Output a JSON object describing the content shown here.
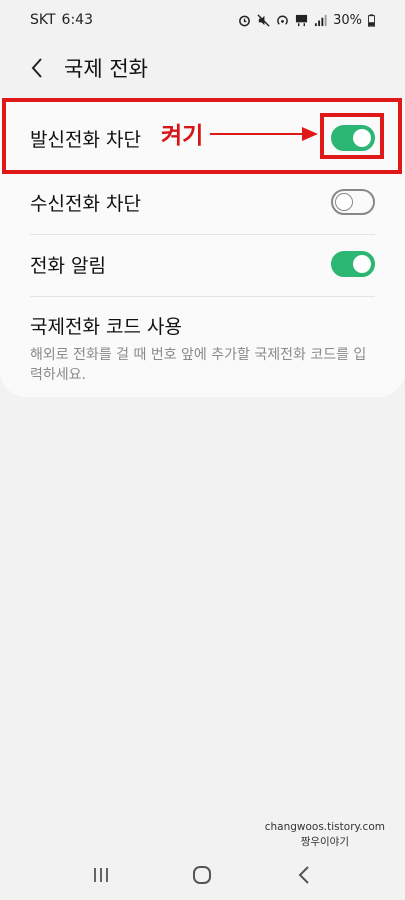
{
  "status_bar": {
    "carrier": "SKT",
    "time": "6:43",
    "battery": "30%",
    "icons": [
      "alarm-icon",
      "mute-icon",
      "hotspot-icon",
      "lte-icon",
      "signal-icon",
      "battery-icon"
    ]
  },
  "header": {
    "title": "국제 전화"
  },
  "settings": {
    "outgoing_block": {
      "label": "발신전화 차단",
      "on": true
    },
    "incoming_block": {
      "label": "수신전화 차단",
      "on": false
    },
    "call_alert": {
      "label": "전화 알림",
      "on": true
    },
    "intl_code": {
      "title": "국제전화 코드 사용",
      "description": "해외로 전화를 걸 때 번호 앞에 추가할 국제전화 코드를 입력하세요."
    }
  },
  "annotation": {
    "text": "켜기",
    "color": "#d61616"
  },
  "watermark": {
    "line1": "changwoos.tistory.com",
    "line2": "짱우이야기"
  },
  "colors": {
    "toggle_on": "#2bb673",
    "background": "#f2f2f2",
    "card": "#fafafa",
    "highlight": "#e01818"
  }
}
